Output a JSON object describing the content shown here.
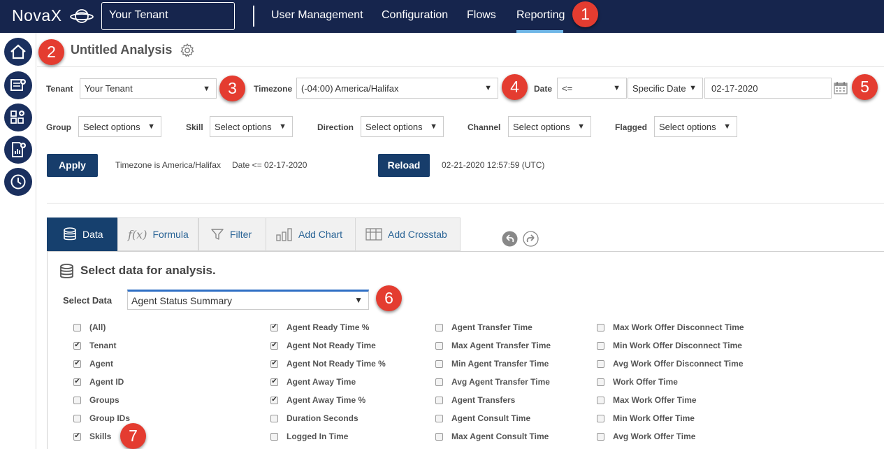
{
  "nav": {
    "logo": "NovaX",
    "tenant": "Your Tenant",
    "items": [
      "User Management",
      "Configuration",
      "Flows",
      "Reporting"
    ]
  },
  "badges": [
    "1",
    "2",
    "3",
    "4",
    "5",
    "6",
    "7"
  ],
  "header": {
    "title": "Untitled Analysis"
  },
  "filters": {
    "tenant_label": "Tenant",
    "tenant_value": "Your Tenant",
    "timezone_label": "Timezone",
    "timezone_value": "(-04:00) America/Halifax",
    "date_label": "Date",
    "date_op": "<=",
    "date_mode": "Specific Date",
    "date_value": "02-17-2020",
    "group_label": "Group",
    "skill_label": "Skill",
    "direction_label": "Direction",
    "channel_label": "Channel",
    "flagged_label": "Flagged",
    "placeholder": "Select options"
  },
  "actions": {
    "apply": "Apply",
    "tz_note": "Timezone is America/Halifax",
    "date_note": "Date <= 02-17-2020",
    "reload": "Reload",
    "reload_time": "02-21-2020 12:57:59 (UTC)"
  },
  "tabs": [
    "Data",
    "Formula",
    "Filter",
    "Add Chart",
    "Add Crosstab"
  ],
  "formula_glyph": "f(x)",
  "section": {
    "title": "Select data for analysis.",
    "select_label": "Select Data",
    "select_value": "Agent Status Summary"
  },
  "columns": [
    [
      {
        "label": "(All)",
        "checked": false
      },
      {
        "label": "Tenant",
        "checked": true
      },
      {
        "label": "Agent",
        "checked": true
      },
      {
        "label": "Agent ID",
        "checked": true
      },
      {
        "label": "Groups",
        "checked": false
      },
      {
        "label": "Group IDs",
        "checked": false
      },
      {
        "label": "Skills",
        "checked": true
      }
    ],
    [
      {
        "label": "Agent Ready Time %",
        "checked": true
      },
      {
        "label": "Agent Not Ready Time",
        "checked": true
      },
      {
        "label": "Agent Not Ready Time %",
        "checked": true
      },
      {
        "label": "Agent Away Time",
        "checked": true
      },
      {
        "label": "Agent Away Time %",
        "checked": true
      },
      {
        "label": "Duration Seconds",
        "checked": false
      },
      {
        "label": "Logged In Time",
        "checked": false
      }
    ],
    [
      {
        "label": "Agent Transfer Time",
        "checked": false
      },
      {
        "label": "Max Agent Transfer Time",
        "checked": false
      },
      {
        "label": "Min Agent Transfer Time",
        "checked": false
      },
      {
        "label": "Avg Agent Transfer Time",
        "checked": false
      },
      {
        "label": "Agent Transfers",
        "checked": false
      },
      {
        "label": "Agent Consult Time",
        "checked": false
      },
      {
        "label": "Max Agent Consult Time",
        "checked": false
      }
    ],
    [
      {
        "label": "Max Work Offer Disconnect Time",
        "checked": false
      },
      {
        "label": "Min Work Offer Disconnect Time",
        "checked": false
      },
      {
        "label": "Avg Work Offer Disconnect Time",
        "checked": false
      },
      {
        "label": "Work Offer Time",
        "checked": false
      },
      {
        "label": "Max Work Offer Time",
        "checked": false
      },
      {
        "label": "Min Work Offer Time",
        "checked": false
      },
      {
        "label": "Avg Work Offer Time",
        "checked": false
      }
    ]
  ],
  "colors": {
    "nav_bg": "#16254d",
    "accent": "#16406e",
    "badge": "#e43c30",
    "active_bar": "#6fb6e6"
  }
}
